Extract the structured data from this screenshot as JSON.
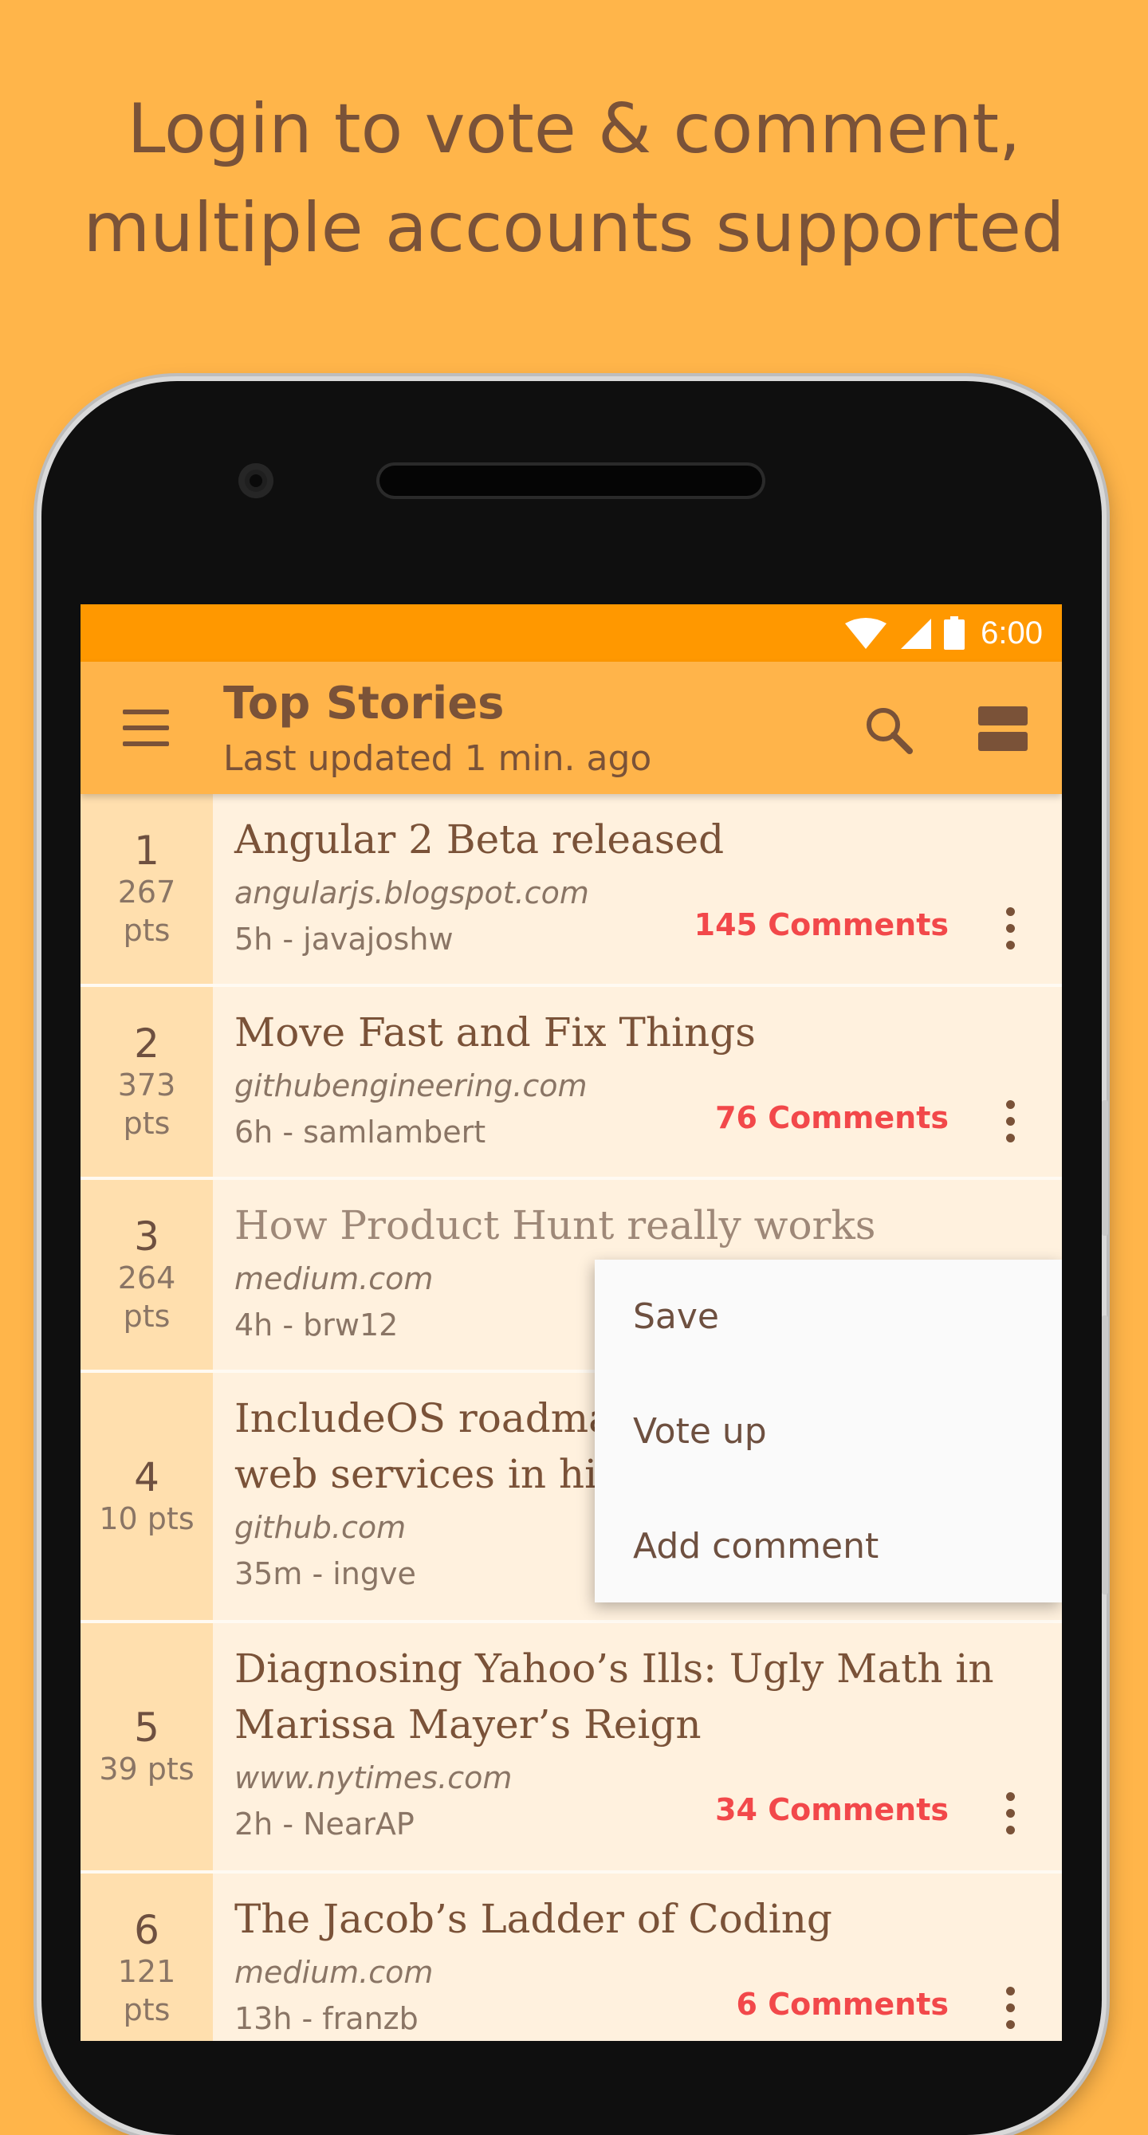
{
  "headline": {
    "line1": "Login to vote & comment,",
    "line2": "multiple accounts supported"
  },
  "colors": {
    "background": "#FFB54A",
    "status_bar": "#FF9800",
    "app_bar": "#FFB44A",
    "list_background": "#FFF1DE",
    "rank_background": "#FFDFAE",
    "comments_accent": "#F2484A",
    "text_brown": "#7A5238"
  },
  "status_bar": {
    "time": "6:00",
    "icons": [
      "wifi-icon",
      "cell-signal-icon",
      "battery-icon"
    ]
  },
  "app_bar": {
    "title": "Top Stories",
    "subtitle": "Last updated 1 min. ago",
    "icons": [
      "menu-icon",
      "search-icon",
      "view-mode-icon"
    ]
  },
  "stories": [
    {
      "rank": "1",
      "points": "267",
      "pts_label": "pts",
      "title": "Angular 2 Beta released",
      "domain": "angularjs.blogspot.com",
      "meta": "5h - javajoshw",
      "comments": "145 Comments"
    },
    {
      "rank": "2",
      "points": "373",
      "pts_label": "pts",
      "title": "Move Fast and Fix Things",
      "domain": "githubengineering.com",
      "meta": "6h - samlambert",
      "comments": "76 Comments"
    },
    {
      "rank": "3",
      "points": "264",
      "pts_label": "pts",
      "title": "How Product Hunt really works",
      "domain": "medium.com",
      "meta": "4h - brw12",
      "comments": ""
    },
    {
      "rank": "4",
      "points": "10 pts",
      "pts_label": "",
      "title_line1": "IncludeOS roadma",
      "title_line2": "web services in hi",
      "domain": "github.com",
      "meta": "35m - ingve",
      "comments": ""
    },
    {
      "rank": "5",
      "points": "39 pts",
      "pts_label": "",
      "title_line1": "Diagnosing Yahoo’s Ills: Ugly Math in",
      "title_line2": "Marissa Mayer’s Reign",
      "domain": "www.nytimes.com",
      "meta": "2h - NearAP",
      "comments": "34 Comments"
    },
    {
      "rank": "6",
      "points": "121",
      "pts_label": "pts",
      "title": "The Jacob’s Ladder of Coding",
      "domain": "medium.com",
      "meta": "13h - franzb",
      "comments": "6 Comments"
    }
  ],
  "popup_menu": {
    "items": [
      "Save",
      "Vote up",
      "Add comment"
    ]
  }
}
